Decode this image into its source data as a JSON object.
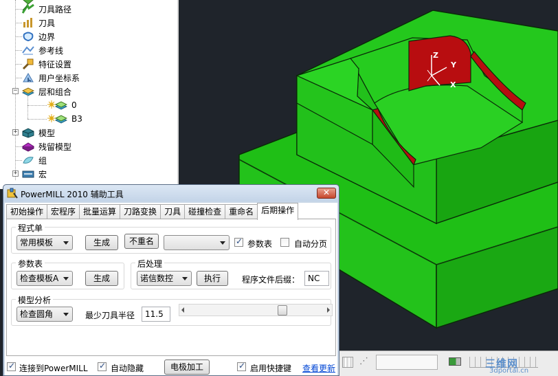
{
  "tree": {
    "items": [
      {
        "label": "",
        "icon": "folder-icon"
      },
      {
        "label": "刀具路径",
        "icon": "toolpath-icon"
      },
      {
        "label": "刀具",
        "icon": "tool-icon"
      },
      {
        "label": "边界",
        "icon": "boundary-icon"
      },
      {
        "label": "参考线",
        "icon": "pattern-icon"
      },
      {
        "label": "特征设置",
        "icon": "feature-icon"
      },
      {
        "label": "用户坐标系",
        "icon": "workplane-icon"
      },
      {
        "label": "层和组合",
        "icon": "layers-icon",
        "expander": "−"
      },
      {
        "label": "0",
        "icon": "layer-icon"
      },
      {
        "label": "B3",
        "icon": "layer-icon"
      },
      {
        "label": "模型",
        "icon": "model-icon",
        "expander": "+"
      },
      {
        "label": "残留模型",
        "icon": "stock-model-icon"
      },
      {
        "label": "组",
        "icon": "group-icon"
      },
      {
        "label": "宏",
        "icon": "macro-icon",
        "expander": "+"
      }
    ]
  },
  "viewport": {
    "axis_z": "Z",
    "axis_y": "Y",
    "axis_x": "X",
    "colors": {
      "model_green": "#23c21b",
      "model_red": "#b80d10",
      "background": "#1f242b"
    }
  },
  "watermark": {
    "line1": "三维网",
    "line2": "3dportal.cn"
  },
  "dialog": {
    "title": "PowerMILL 2010 辅助工具",
    "close_label": "✕",
    "tabs": [
      {
        "label": "初始操作",
        "active": false
      },
      {
        "label": "宏程序",
        "active": false
      },
      {
        "label": "批量运算",
        "active": false
      },
      {
        "label": "刀路变换",
        "active": false
      },
      {
        "label": "刀具",
        "active": false
      },
      {
        "label": "碰撞检查",
        "active": false
      },
      {
        "label": "重命名",
        "active": false
      },
      {
        "label": "后期操作",
        "active": true
      }
    ],
    "program": {
      "group_label": "程式单",
      "template_value": "常用模板",
      "generate_label": "生成",
      "no_rename_label": "不重名",
      "extra_value": "",
      "params_table_label": "参数表",
      "params_table_checked": true,
      "auto_page_label": "自动分页",
      "auto_page_checked": false
    },
    "params": {
      "group_label": "参数表",
      "template_value": "检查模板A",
      "generate_label": "生成"
    },
    "post": {
      "group_label": "后处理",
      "post_value": "诺信数控",
      "run_label": "执行",
      "suffix_label": "程序文件后缀：",
      "suffix_value": "NC"
    },
    "model_analysis": {
      "group_label": "模型分析",
      "check_value": "检查圆角",
      "min_radius_label": "最少刀具半径",
      "min_radius_value": "11.5",
      "slider_level": 0.7
    },
    "bottom": {
      "connect_label": "连接到PowerMILL",
      "connect_checked": true,
      "auto_hide_label": "自动隐藏",
      "auto_hide_checked": true,
      "electrode_label": "电极加工",
      "hotkey_label": "启用快捷键",
      "hotkey_checked": true,
      "update_link": "查看更新"
    }
  }
}
